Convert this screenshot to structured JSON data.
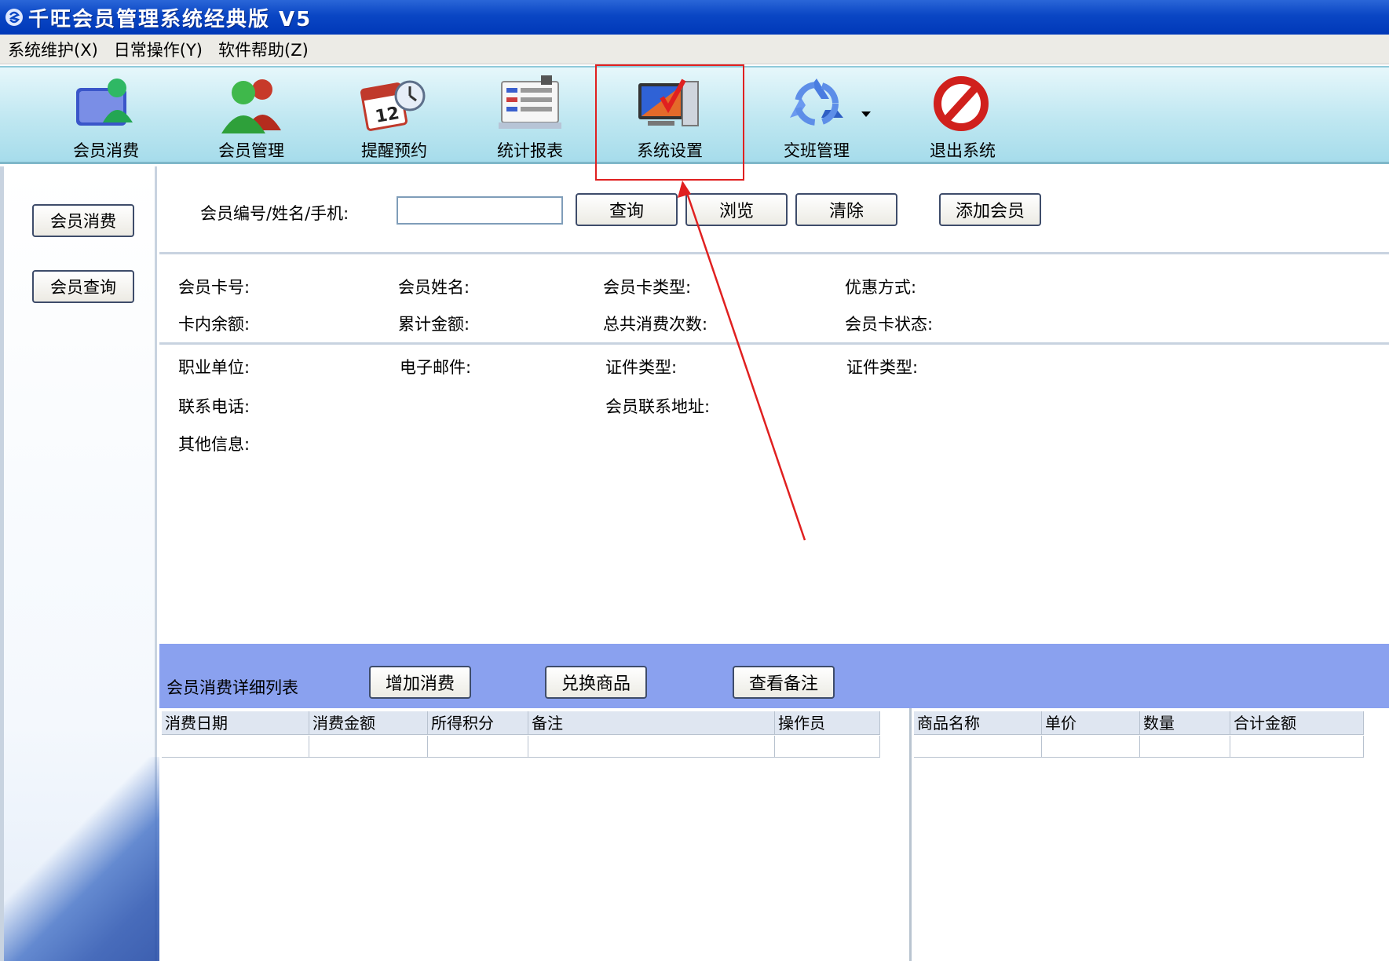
{
  "window": {
    "title": "千旺会员管理系统经典版 V5"
  },
  "menu": [
    {
      "label": "系统维护(X)"
    },
    {
      "label": "日常操作(Y)"
    },
    {
      "label": "软件帮助(Z)"
    }
  ],
  "toolbar": [
    {
      "label": "会员消费",
      "icon": "member-consume-icon"
    },
    {
      "label": "会员管理",
      "icon": "member-manage-icon"
    },
    {
      "label": "提醒预约",
      "icon": "calendar-clock-icon"
    },
    {
      "label": "统计报表",
      "icon": "report-icon"
    },
    {
      "label": "系统设置",
      "icon": "settings-computer-icon"
    },
    {
      "label": "交班管理",
      "icon": "recycle-icon"
    },
    {
      "label": "退出系统",
      "icon": "no-entry-icon"
    }
  ],
  "sidebar": {
    "buttons": [
      {
        "label": "会员消费"
      },
      {
        "label": "会员查询"
      }
    ]
  },
  "search": {
    "label": "会员编号/姓名/手机:",
    "value": "",
    "buttons": {
      "query": "查询",
      "browse": "浏览",
      "clear": "清除",
      "add_member": "添加会员"
    }
  },
  "member_info": {
    "card_no": "会员卡号:",
    "name": "会员姓名:",
    "card_type": "会员卡类型:",
    "discount": "优惠方式:",
    "balance": "卡内余额:",
    "total_amount": "累计金额:",
    "consume_count": "总共消费次数:",
    "card_status": "会员卡状态:"
  },
  "member_detail": {
    "employer": "职业单位:",
    "email": "电子邮件:",
    "id_type_1": "证件类型:",
    "id_type_2": "证件类型:",
    "phone": "联系电话:",
    "address": "会员联系地址:",
    "other": "其他信息:"
  },
  "detail_section": {
    "title": "会员消费详细列表",
    "buttons": {
      "add_consume": "增加消费",
      "redeem": "兑换商品",
      "view_note": "查看备注"
    }
  },
  "consume_table": {
    "columns": [
      "消费日期",
      "消费金额",
      "所得积分",
      "备注",
      "操作员"
    ]
  },
  "goods_table": {
    "columns": [
      "商品名称",
      "单价",
      "数量",
      "合计金额"
    ]
  },
  "colors": {
    "titlebar": "#0a46c4",
    "toolbar": "#bfe7f1",
    "detail_bar": "#8aa1ef",
    "highlight": "#e02020"
  }
}
